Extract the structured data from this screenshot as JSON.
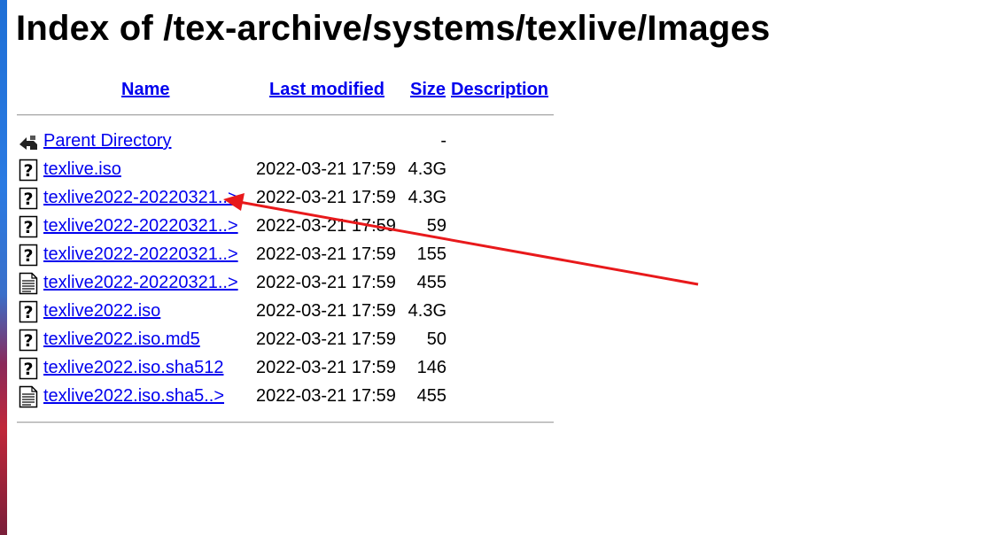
{
  "page": {
    "title": "Index of /tex-archive/systems/texlive/Images"
  },
  "columns": {
    "name": "Name",
    "last_modified": "Last modified",
    "size": "Size",
    "description": "Description"
  },
  "rows": [
    {
      "icon": "back-icon",
      "name": "Parent Directory",
      "date": "",
      "size": "-"
    },
    {
      "icon": "unknown-file-icon",
      "name": "texlive.iso",
      "date": "2022-03-21 17:59",
      "size": "4.3G"
    },
    {
      "icon": "unknown-file-icon",
      "name": "texlive2022-20220321..>",
      "date": "2022-03-21 17:59",
      "size": "4.3G"
    },
    {
      "icon": "unknown-file-icon",
      "name": "texlive2022-20220321..>",
      "date": "2022-03-21 17:59",
      "size": "59"
    },
    {
      "icon": "unknown-file-icon",
      "name": "texlive2022-20220321..>",
      "date": "2022-03-21 17:59",
      "size": "155"
    },
    {
      "icon": "text-file-icon",
      "name": "texlive2022-20220321..>",
      "date": "2022-03-21 17:59",
      "size": "455"
    },
    {
      "icon": "unknown-file-icon",
      "name": "texlive2022.iso",
      "date": "2022-03-21 17:59",
      "size": "4.3G"
    },
    {
      "icon": "unknown-file-icon",
      "name": "texlive2022.iso.md5",
      "date": "2022-03-21 17:59",
      "size": "50"
    },
    {
      "icon": "unknown-file-icon",
      "name": "texlive2022.iso.sha512",
      "date": "2022-03-21 17:59",
      "size": "146"
    },
    {
      "icon": "text-file-icon",
      "name": "texlive2022.iso.sha5..>",
      "date": "2022-03-21 17:59",
      "size": "455"
    }
  ],
  "colors": {
    "link": "#0000ee",
    "annotation_arrow": "#e8191b"
  }
}
